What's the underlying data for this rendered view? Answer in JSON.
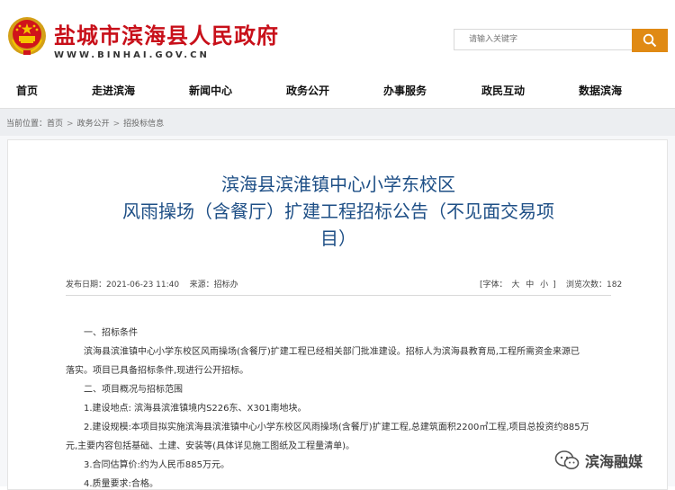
{
  "header": {
    "site_title": "盐城市滨海县人民政府",
    "site_url": "WWW.BINHAI.GOV.CN",
    "search_placeholder": "请输入关键字",
    "emblem_icon": "national-emblem-icon",
    "search_icon": "search-icon"
  },
  "nav": {
    "items": [
      "首页",
      "走进滨海",
      "新闻中心",
      "政务公开",
      "办事服务",
      "政民互动",
      "数据滨海"
    ]
  },
  "breadcrumb": {
    "label": "当前位置：",
    "items": [
      "首页",
      "政务公开",
      "招投标信息"
    ],
    "separator": ">"
  },
  "article": {
    "title_lines": [
      "滨海县滨淮镇中心小学东校区",
      "风雨操场（含餐厅）扩建工程招标公告（不见面交易项",
      "目）"
    ],
    "publish_time": "发布日期：2021-06-23 11:40",
    "source": "来源：招标办",
    "font_label_open": "[字体：",
    "font_sizes": [
      "大",
      "中",
      "小"
    ],
    "font_label_close": "]",
    "views": "浏览次数：182",
    "body": [
      "一、招标条件",
      "滨海县滨淮镇中心小学东校区风雨操场(含餐厅)扩建工程已经相关部门批准建设。招标人为滨海县教育局,工程所需资金来源已",
      "落实。项目已具备招标条件,现进行公开招标。",
      "二、项目概况与招标范围",
      "1.建设地点: 滨海县滨淮镇境内S226东、X301南地块。",
      "2.建设规模:本项目拟实施滨海县滨淮镇中心小学东校区风雨操场(含餐厅)扩建工程,总建筑面积2200㎡工程,项目总投资约885万",
      "元,主要内容包括基础、土建、安装等(具体详见施工图纸及工程量清单)。",
      "3.合同估算价:约为人民币885万元。",
      "4.质量要求:合格。"
    ]
  },
  "watermark": {
    "text": "滨海融媒",
    "icon": "wechat-icon"
  },
  "colors": {
    "brand_red": "#c8101a",
    "title_blue": "#1e4f86",
    "search_orange": "#e08a14",
    "crumb_bg": "#eceef1"
  }
}
